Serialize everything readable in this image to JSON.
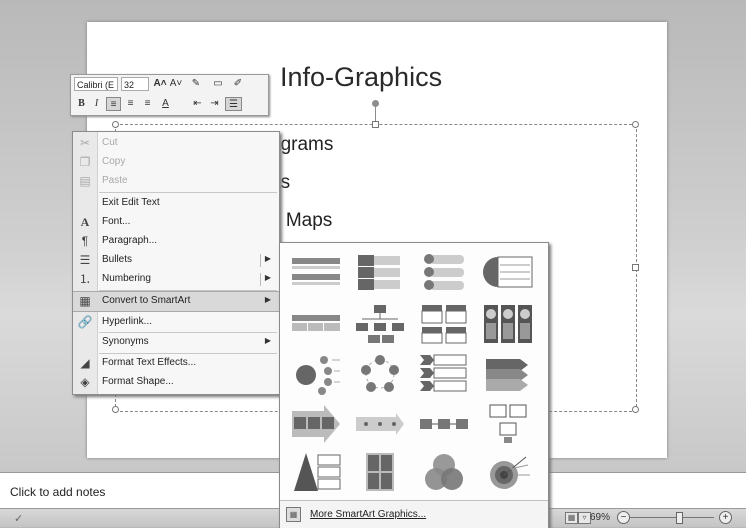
{
  "slide": {
    "title": "Info-Graphics",
    "bullets": [
      "agrams",
      "as",
      "d Maps"
    ]
  },
  "notes": {
    "placeholder": "Click to add notes"
  },
  "status_bar": {
    "zoom_percent": "69%"
  },
  "mini_toolbar": {
    "font_name": "Calibri (E",
    "font_size": "32",
    "bold": "B",
    "italic": "I",
    "grow_font": "A˄",
    "shrink_font": "A˅",
    "font_color": "A"
  },
  "context_menu": {
    "items": [
      {
        "label": "Cut",
        "icon": "scissors-icon",
        "disabled": true
      },
      {
        "label": "Copy",
        "icon": "copy-icon",
        "disabled": true
      },
      {
        "label": "Paste",
        "icon": "paste-icon",
        "disabled": true
      },
      {
        "label": "Exit Edit Text",
        "icon": "",
        "disabled": false
      },
      {
        "label": "Font...",
        "icon": "font-icon",
        "disabled": false
      },
      {
        "label": "Paragraph...",
        "icon": "paragraph-icon",
        "disabled": false
      },
      {
        "label": "Bullets",
        "icon": "bullets-icon",
        "disabled": false,
        "submenu": true
      },
      {
        "label": "Numbering",
        "icon": "numbering-icon",
        "disabled": false,
        "submenu": true
      },
      {
        "label": "Convert to SmartArt",
        "icon": "smartart-icon",
        "disabled": false,
        "submenu": true,
        "highlighted": true
      },
      {
        "label": "Hyperlink...",
        "icon": "hyperlink-icon",
        "disabled": false
      },
      {
        "label": "Synonyms",
        "icon": "",
        "disabled": false,
        "submenu": true
      },
      {
        "label": "Format Text Effects...",
        "icon": "text-effects-icon",
        "disabled": false
      },
      {
        "label": "Format Shape...",
        "icon": "format-shape-icon",
        "disabled": false
      }
    ]
  },
  "smartart_gallery": {
    "layouts": [
      "vertical-bullet-list",
      "stacked-list",
      "vertical-box-list",
      "horizontal-bullet-list",
      "table-list",
      "hierarchy",
      "labeled-list",
      "picture-list",
      "radial-cluster",
      "basic-cycle",
      "vertical-chevron-list",
      "vertical-arrow-list",
      "basic-process",
      "arrow-process",
      "step-process",
      "picture-grid",
      "pyramid",
      "matrix",
      "venn",
      "target"
    ],
    "more_label": "More SmartArt Graphics..."
  }
}
